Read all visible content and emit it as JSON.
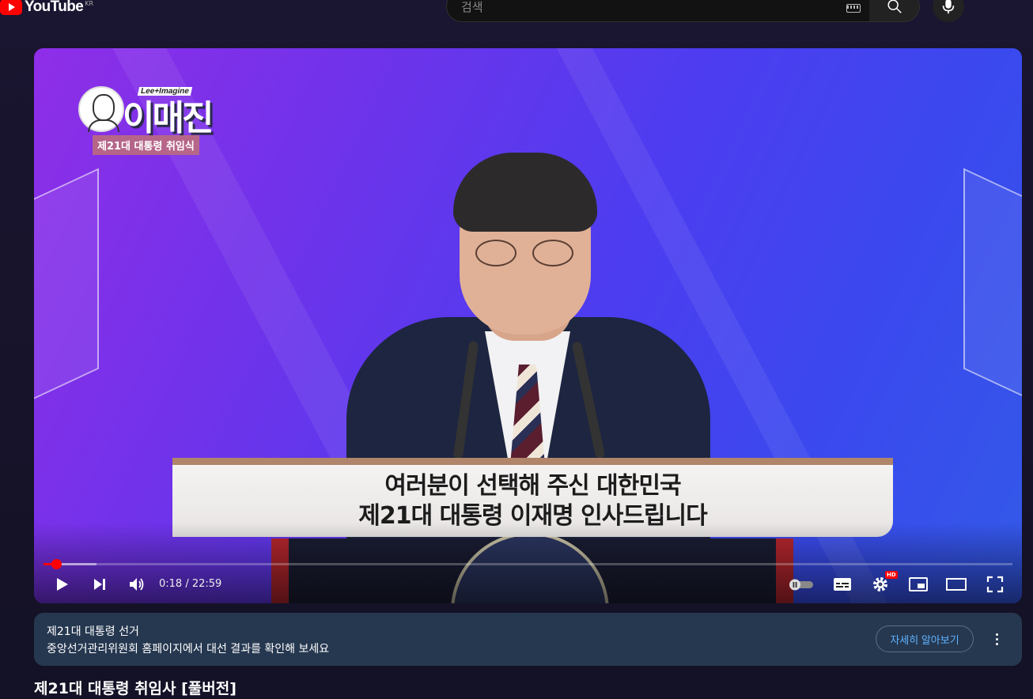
{
  "header": {
    "logo_text": "YouTube",
    "logo_region": "KR",
    "search_placeholder": "검색"
  },
  "player": {
    "watermark": {
      "brand_tag": "Lee+Imagine",
      "brand_title": "이매진",
      "subtitle": "제21대 대통령 취임식"
    },
    "caption_lines": [
      "여러분이 선택해 주신 대한민국",
      "제21대 대통령 이재명 인사드립니다"
    ],
    "current_time": "0:18",
    "duration": "22:59",
    "time_separator": " / ",
    "progress_played_fraction": 0.013,
    "progress_loaded_fraction": 0.055,
    "settings_badge": "HD",
    "colors": {
      "progress": "#ff0000",
      "accent_link": "#5fb2ff"
    }
  },
  "info_banner": {
    "title": "제21대 대통령 선거",
    "text": "중앙선거관리위원회 홈페이지에서 대선 결과를 확인해 보세요",
    "button_label": "자세히 알아보기"
  },
  "video": {
    "title": "제21대 대통령 취임사 [풀버전]"
  }
}
